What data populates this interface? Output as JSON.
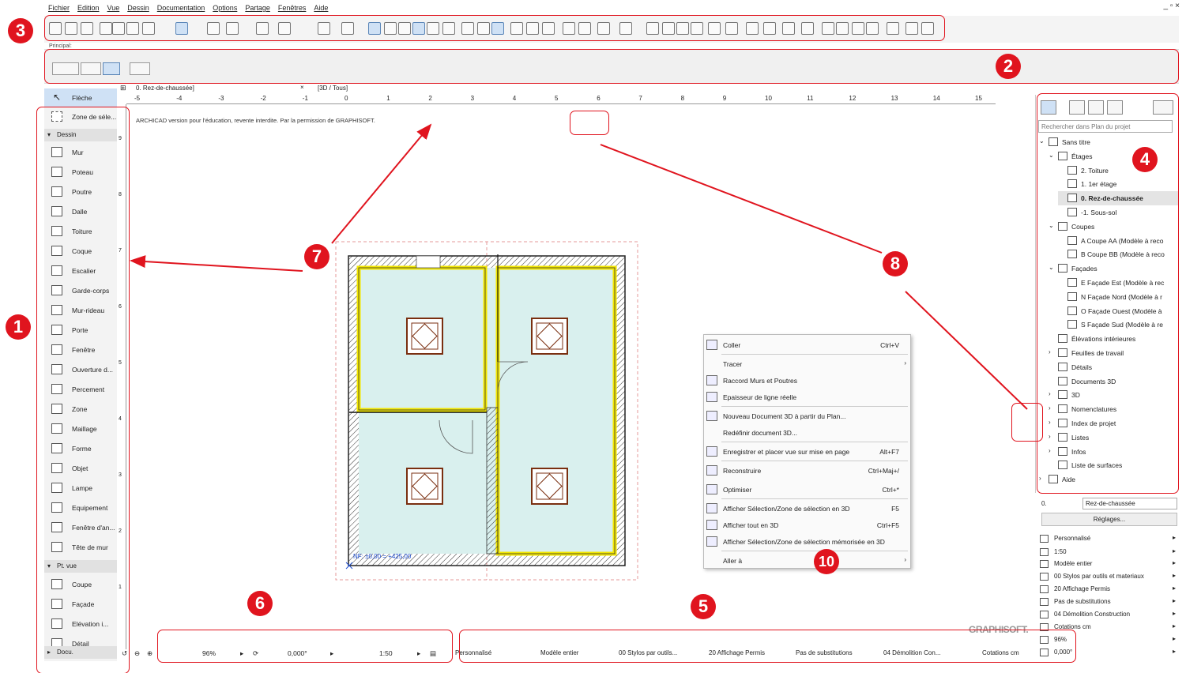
{
  "menubar": {
    "items": [
      "Fichier",
      "Edition",
      "Vue",
      "Dessin",
      "Documentation",
      "Options",
      "Partage",
      "Fenêtres",
      "Aide"
    ],
    "window_controls": "_ ▫ ×"
  },
  "principal_label": "Principal:",
  "tabs": {
    "plan_tab": "0. Rez-de-chaussée]",
    "close": "×",
    "view3d_tab": "[3D / Tous]"
  },
  "ruler": {
    "h_ticks": [
      "-5",
      "-4",
      "-3",
      "-2",
      "-1",
      "0",
      "1",
      "2",
      "3",
      "4",
      "5",
      "6",
      "7",
      "8",
      "9",
      "10",
      "11",
      "12",
      "13",
      "14",
      "15"
    ],
    "v_ticks": [
      "9",
      "8",
      "7",
      "6",
      "5",
      "4",
      "3",
      "2",
      "1"
    ]
  },
  "toolbox": {
    "arrow": "Flèche",
    "selection_zone": "Zone de séle...",
    "section_dessin": "Dessin",
    "tools": [
      "Mur",
      "Poteau",
      "Poutre",
      "Dalle",
      "Toiture",
      "Coque",
      "Escalier",
      "Garde-corps",
      "Mur-rideau",
      "Porte",
      "Fenêtre",
      "Ouverture d...",
      "Percement",
      "Zone",
      "Maillage",
      "Forme",
      "Objet",
      "Lampe",
      "Equipement",
      "Fenêtre d'an...",
      "Tête de mur"
    ],
    "section_ptvue": "Pt. vue",
    "view_tools": [
      "Coupe",
      "Façade",
      "Elévation i...",
      "Détail"
    ],
    "section_docu": "Docu."
  },
  "canvas": {
    "notice": "ARCHICAD version pour l'éducation, revente interdite. Par la permission de GRAPHISOFT.",
    "level_label": "NF: ±0,00 = +425,00",
    "brand": "GRAPHISOFT."
  },
  "context_menu": {
    "items": [
      {
        "label": "Coller",
        "shortcut": "Ctrl+V",
        "arrow": ""
      },
      {
        "label": "Tracer",
        "shortcut": "",
        "arrow": "›"
      },
      {
        "label": "Raccord Murs et Poutres",
        "shortcut": "",
        "arrow": ""
      },
      {
        "label": "Epaisseur de ligne réelle",
        "shortcut": "",
        "arrow": ""
      },
      {
        "label": "Nouveau Document 3D à partir du Plan...",
        "shortcut": "",
        "arrow": ""
      },
      {
        "label": "Redéfinir document 3D...",
        "shortcut": "",
        "arrow": ""
      },
      {
        "label": "Enregistrer et placer vue sur mise en page",
        "shortcut": "Alt+F7",
        "arrow": ""
      },
      {
        "label": "Reconstruire",
        "shortcut": "Ctrl+Maj+/",
        "arrow": ""
      },
      {
        "label": "Optimiser",
        "shortcut": "Ctrl+*",
        "arrow": ""
      },
      {
        "label": "Afficher Sélection/Zone de sélection en 3D",
        "shortcut": "F5",
        "arrow": ""
      },
      {
        "label": "Afficher tout en 3D",
        "shortcut": "Ctrl+F5",
        "arrow": ""
      },
      {
        "label": "Afficher Sélection/Zone de sélection mémorisée en 3D",
        "shortcut": "",
        "arrow": ""
      },
      {
        "label": "Aller à",
        "shortcut": "",
        "arrow": "›"
      }
    ]
  },
  "navigator": {
    "search_placeholder": "Rechercher dans Plan du projet",
    "tree": [
      {
        "label": "Sans titre",
        "chev": "⌄",
        "indent": 0,
        "selected": false
      },
      {
        "label": "Étages",
        "chev": "⌄",
        "indent": 1,
        "selected": false
      },
      {
        "label": "2. Toiture",
        "chev": "",
        "indent": 2,
        "selected": false
      },
      {
        "label": "1. 1er étage",
        "chev": "",
        "indent": 2,
        "selected": false
      },
      {
        "label": "0. Rez-de-chaussée",
        "chev": "",
        "indent": 2,
        "selected": true
      },
      {
        "label": "-1. Sous-sol",
        "chev": "",
        "indent": 2,
        "selected": false
      },
      {
        "label": "Coupes",
        "chev": "⌄",
        "indent": 1,
        "selected": false
      },
      {
        "label": "A Coupe AA (Modèle à reco",
        "chev": "",
        "indent": 2,
        "selected": false
      },
      {
        "label": "B Coupe BB (Modèle à reco",
        "chev": "",
        "indent": 2,
        "selected": false
      },
      {
        "label": "Façades",
        "chev": "⌄",
        "indent": 1,
        "selected": false
      },
      {
        "label": "E Façade Est (Modèle à rec",
        "chev": "",
        "indent": 2,
        "selected": false
      },
      {
        "label": "N Façade Nord (Modèle à r",
        "chev": "",
        "indent": 2,
        "selected": false
      },
      {
        "label": "O Façade Ouest (Modèle à",
        "chev": "",
        "indent": 2,
        "selected": false
      },
      {
        "label": "S Façade Sud (Modèle à re",
        "chev": "",
        "indent": 2,
        "selected": false
      },
      {
        "label": "Élévations intérieures",
        "chev": "",
        "indent": 1,
        "selected": false
      },
      {
        "label": "Feuilles de travail",
        "chev": "›",
        "indent": 1,
        "selected": false
      },
      {
        "label": "Détails",
        "chev": "",
        "indent": 1,
        "selected": false
      },
      {
        "label": "Documents 3D",
        "chev": "",
        "indent": 1,
        "selected": false
      },
      {
        "label": "3D",
        "chev": "›",
        "indent": 1,
        "selected": false
      },
      {
        "label": "Nomenclatures",
        "chev": "›",
        "indent": 1,
        "selected": false
      },
      {
        "label": "Index de projet",
        "chev": "›",
        "indent": 1,
        "selected": false
      },
      {
        "label": "Listes",
        "chev": "›",
        "indent": 1,
        "selected": false
      },
      {
        "label": "Infos",
        "chev": "›",
        "indent": 1,
        "selected": false
      },
      {
        "label": "Liste de surfaces",
        "chev": "",
        "indent": 1,
        "selected": false
      },
      {
        "label": "Aide",
        "chev": "›",
        "indent": 0,
        "selected": false
      }
    ]
  },
  "props": {
    "story_id": "0.",
    "story_name": "Rez-de-chaussée",
    "settings_button": "Réglages...",
    "rows": [
      "Personnalisé",
      "1:50",
      "Modèle entier",
      "00 Stylos par outils et materiaux",
      "20 Affichage Permis",
      "Pas de substitutions",
      "04 Démolition Construction",
      "Cotations cm",
      "96%",
      "0,000°"
    ]
  },
  "zoombar": {
    "zoom": "96%",
    "angle": "0,000°",
    "scale": "1:50"
  },
  "viewbar": {
    "items": [
      "Personnalisé",
      "Modèle entier",
      "00 Stylos par outils...",
      "20 Affichage Permis",
      "Pas de substitutions",
      "04 Démolition Con...",
      "Cotations cm"
    ]
  },
  "badges": [
    "1",
    "2",
    "3",
    "4",
    "5",
    "6",
    "7",
    "8",
    "10"
  ],
  "colors": {
    "annotation_red": "#e0141e",
    "room_fill": "#d9f0ee",
    "wall_yellow": "#f2e600",
    "selection_blue": "#cfe1f5",
    "level_blue": "#1e4fd2"
  }
}
